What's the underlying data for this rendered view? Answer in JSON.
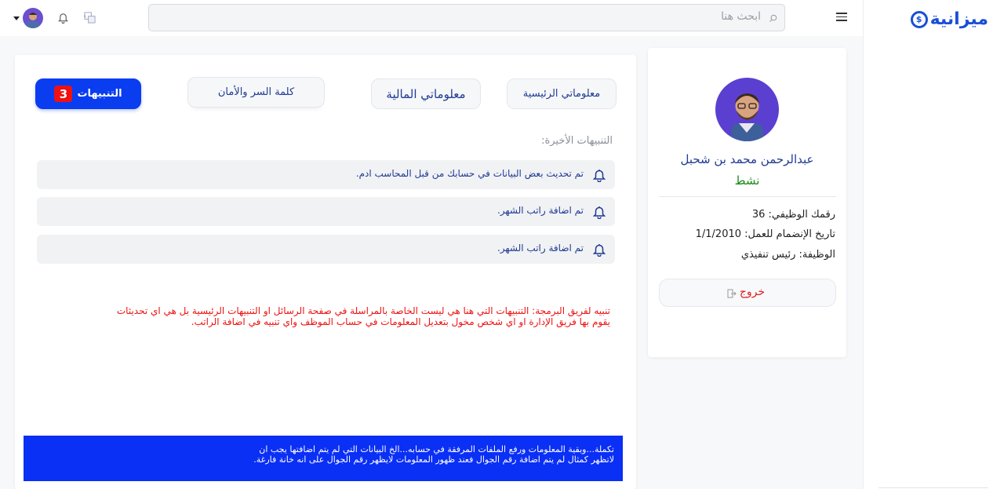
{
  "brand": {
    "name": "ميزانية",
    "coin_symbol": "$",
    "color": "#1a4fd6"
  },
  "topbar": {
    "search_placeholder": "ابحث هنا"
  },
  "profile": {
    "name": "عبدالرحمن محمد بن شحبل",
    "status": "نشط",
    "employee_id": "رقمك الوظيفي: 36",
    "join_date": "تاريخ الإنضمام للعمل: 1/1/2010",
    "job": "الوظيفة: رئيس تنفيذي",
    "logout_label": "خروج"
  },
  "tabs": [
    {
      "label": "معلوماتي الرئيسية"
    },
    {
      "label": "معلوماتي المالية"
    },
    {
      "label": "كلمة السر والأمان"
    },
    {
      "label": "التنبيهات",
      "badge": "3"
    }
  ],
  "notifications": {
    "title": "التنبيهات الأخيرة:",
    "items": [
      {
        "text": "تم تحديث بعض البيانات في حسابك من قبل المحاسب ادم."
      },
      {
        "text": "تم اضافة راتب الشهر."
      },
      {
        "text": "تم اضافة راتب الشهر."
      }
    ]
  },
  "dev_note": {
    "line1": "تنبيه لفريق البرمجة: التنبيهات التي هنا هي ليست الخاصة بالمراسلة في صفحة الرسائل او التنبيهات الرئيسية بل هي اي تحديثات",
    "line2": "يقوم بها فريق الإدارة او اي شخص مخول بتعديل المعلومات في حساب الموظف واي تنبيه في اضافة الراتب."
  },
  "banner": {
    "line1": "تكملة...وبقية المعلومات ورفع الملفات المرفقة في حسابه...الخ البيانات التي لم يتم اضافتها يجب ان",
    "line2": "لاتظهر كمثال لم يتم اضافة رقم الجوال فعند ظهور المعلومات لايظهر رقم الجوال على انه خانة فارغة."
  },
  "colors": {
    "accent": "#0a3df0",
    "danger": "#ee1111",
    "success": "#1a8a1a",
    "heading": "#1f3a93"
  }
}
